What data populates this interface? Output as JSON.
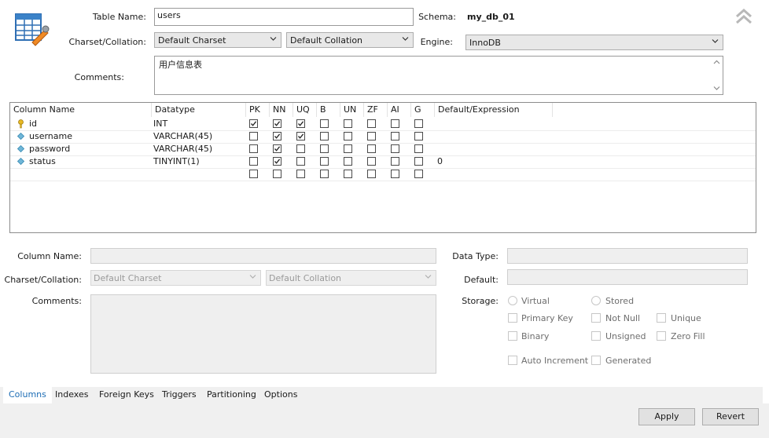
{
  "header": {
    "table_name_label": "Table Name:",
    "table_name_value": "users",
    "schema_label": "Schema:",
    "schema_value": "my_db_01",
    "charset_label": "Charset/Collation:",
    "charset_value": "Default Charset",
    "collation_value": "Default Collation",
    "engine_label": "Engine:",
    "engine_value": "InnoDB",
    "comments_label": "Comments:",
    "comments_value": "用户信息表"
  },
  "grid": {
    "headers": [
      "Column Name",
      "Datatype",
      "PK",
      "NN",
      "UQ",
      "B",
      "UN",
      "ZF",
      "AI",
      "G",
      "Default/Expression"
    ],
    "rows": [
      {
        "name": "id",
        "icon": "key-icon",
        "datatype": "INT",
        "flags": [
          true,
          true,
          true,
          false,
          false,
          false,
          false,
          false
        ],
        "default": ""
      },
      {
        "name": "username",
        "icon": "diamond-icon",
        "datatype": "VARCHAR(45)",
        "flags": [
          false,
          true,
          true,
          false,
          false,
          false,
          false,
          false
        ],
        "default": ""
      },
      {
        "name": "password",
        "icon": "diamond-icon",
        "datatype": "VARCHAR(45)",
        "flags": [
          false,
          true,
          false,
          false,
          false,
          false,
          false,
          false
        ],
        "default": ""
      },
      {
        "name": "status",
        "icon": "diamond-icon",
        "datatype": "TINYINT(1)",
        "flags": [
          false,
          true,
          false,
          false,
          false,
          false,
          false,
          false
        ],
        "default": "0"
      }
    ]
  },
  "details": {
    "column_name_label": "Column Name:",
    "charset_label": "Charset/Collation:",
    "charset_placeholder": "Default Charset",
    "collation_placeholder": "Default Collation",
    "comments_label": "Comments:",
    "data_type_label": "Data Type:",
    "default_label": "Default:",
    "storage_label": "Storage:",
    "virtual_label": "Virtual",
    "stored_label": "Stored",
    "primary_key_label": "Primary Key",
    "not_null_label": "Not Null",
    "unique_label": "Unique",
    "binary_label": "Binary",
    "unsigned_label": "Unsigned",
    "zero_fill_label": "Zero Fill",
    "auto_increment_label": "Auto Increment",
    "generated_label": "Generated"
  },
  "tabs": [
    "Columns",
    "Indexes",
    "Foreign Keys",
    "Triggers",
    "Partitioning",
    "Options"
  ],
  "active_tab": "Columns",
  "buttons": {
    "apply": "Apply",
    "revert": "Revert"
  },
  "colors": {
    "accent": "#1d6db5",
    "key": "#e8b923",
    "diamond": "#6fb6d8"
  }
}
